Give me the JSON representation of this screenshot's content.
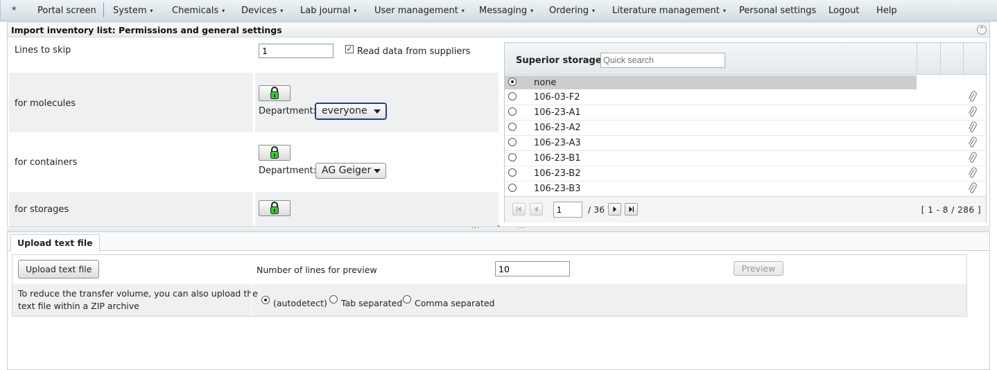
{
  "menu": {
    "items": [
      {
        "label": "*",
        "caret": false
      },
      {
        "label": "Portal screen",
        "caret": false
      },
      {
        "label": "System",
        "caret": true
      },
      {
        "label": "Chemicals",
        "caret": true
      },
      {
        "label": "Devices",
        "caret": true
      },
      {
        "label": "Lab journal",
        "caret": true
      },
      {
        "label": "User management",
        "caret": true
      },
      {
        "label": "Messaging",
        "caret": true
      },
      {
        "label": "Ordering",
        "caret": true
      },
      {
        "label": "Literature management",
        "caret": true
      },
      {
        "label": "Personal settings",
        "caret": false
      },
      {
        "label": "Logout",
        "caret": false
      },
      {
        "label": "Help",
        "caret": false
      }
    ],
    "caret_glyph": "▾"
  },
  "panel": {
    "title": "Import inventory list: Permissions and general settings",
    "collapse_glyph": "⌃"
  },
  "form": {
    "lines_to_skip_label": "Lines to skip",
    "lines_to_skip_value": "1",
    "read_suppliers_label": "Read data from suppliers",
    "read_suppliers_checked": true,
    "checkmark": "✓",
    "molecules_label": "for molecules",
    "containers_label": "for containers",
    "storages_label": "for storages",
    "department_label": "Department:",
    "molecules_department": "everyone",
    "containers_department": "AG Geiger"
  },
  "storage": {
    "title": "Superior storage",
    "search_placeholder": "Quick search",
    "rows": [
      {
        "name": "none",
        "selected": true,
        "attachment": false
      },
      {
        "name": "106-03-F2",
        "selected": false,
        "attachment": true
      },
      {
        "name": "106-23-A1",
        "selected": false,
        "attachment": true
      },
      {
        "name": "106-23-A2",
        "selected": false,
        "attachment": true
      },
      {
        "name": "106-23-A3",
        "selected": false,
        "attachment": true
      },
      {
        "name": "106-23-B1",
        "selected": false,
        "attachment": true
      },
      {
        "name": "106-23-B2",
        "selected": false,
        "attachment": true
      },
      {
        "name": "106-23-B3",
        "selected": false,
        "attachment": true
      }
    ],
    "pager": {
      "page": "1",
      "total": "/ 36",
      "range": "[ 1 - 8 / 286 ]"
    }
  },
  "upload": {
    "tab_label": "Upload text file",
    "button_label": "Upload text file",
    "preview_lines_label": "Number of lines for preview",
    "preview_lines_value": "10",
    "preview_button": "Preview",
    "zip_note_line1": "To reduce the transfer volume, you can also upload the",
    "zip_note_line2": "text file within a ZIP archive",
    "separator_options": [
      {
        "label": "(autodetect)",
        "selected": true
      },
      {
        "label": "Tab separated",
        "selected": false
      },
      {
        "label": "Comma separated",
        "selected": false
      }
    ]
  },
  "colors": {
    "menubar_top": "#eef3f6",
    "menubar_bottom": "#d3dde3",
    "selected_row": "#cdcdcd",
    "lock_green": "#2fcf2f",
    "shade": "#eef0f1"
  },
  "icons": {
    "lock": "lock-open-icon",
    "attachment": "paperclip-icon",
    "pager_first": "first-page-icon",
    "pager_prev": "prev-page-icon",
    "pager_next": "next-page-icon",
    "pager_last": "last-page-icon"
  }
}
